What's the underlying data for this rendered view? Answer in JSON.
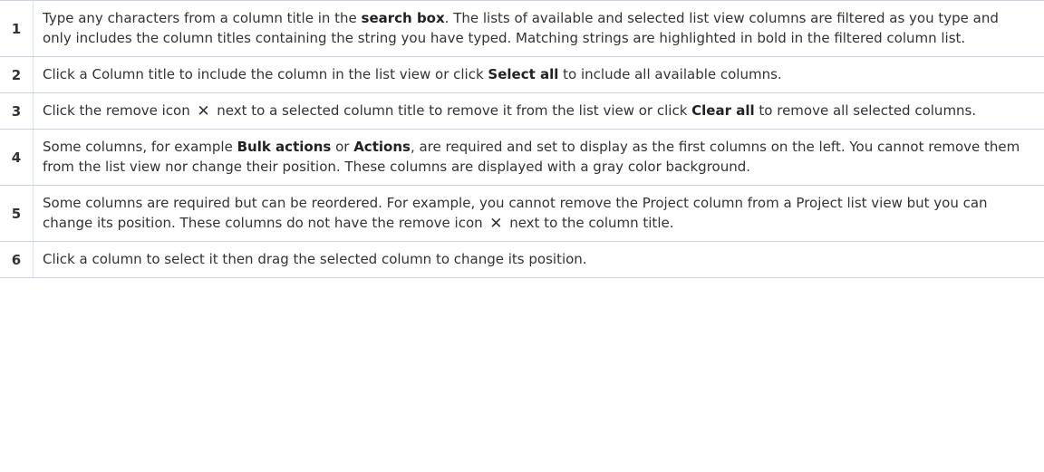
{
  "steps": [
    {
      "number": "1",
      "segments": [
        {
          "text": "Type any characters from a column title in the "
        },
        {
          "text": "search box",
          "bold": true
        },
        {
          "text": ". The lists of available and selected list view columns are filtered as you type and only includes the column titles containing the string you have typed. Matching strings are highlighted in bold in the filtered column list."
        }
      ]
    },
    {
      "number": "2",
      "segments": [
        {
          "text": "Click a Column title to include the column in the list view or click "
        },
        {
          "text": "Select all",
          "bold": true
        },
        {
          "text": " to include all available columns."
        }
      ]
    },
    {
      "number": "3",
      "segments": [
        {
          "text": "Click the remove icon "
        },
        {
          "icon": "close-icon"
        },
        {
          "text": " next to a selected column title to remove it from the list view or click "
        },
        {
          "text": "Clear all",
          "bold": true
        },
        {
          "text": " to remove all selected columns."
        }
      ]
    },
    {
      "number": "4",
      "segments": [
        {
          "text": "Some columns, for example "
        },
        {
          "text": "Bulk actions",
          "bold": true
        },
        {
          "text": " or "
        },
        {
          "text": "Actions",
          "bold": true
        },
        {
          "text": ", are required and set to display as the first columns on the left. You cannot remove them from the list view nor change their position. These columns are displayed with a gray color background."
        }
      ]
    },
    {
      "number": "5",
      "segments": [
        {
          "text": "Some columns are required but can be reordered. For example, you cannot remove the Project column from a Project list view but you can change its position. These columns do not have the remove icon "
        },
        {
          "icon": "close-icon"
        },
        {
          "text": " next to the column title."
        }
      ]
    },
    {
      "number": "6",
      "segments": [
        {
          "text": "Click a column to select it then drag the selected column to change its position."
        }
      ]
    }
  ]
}
